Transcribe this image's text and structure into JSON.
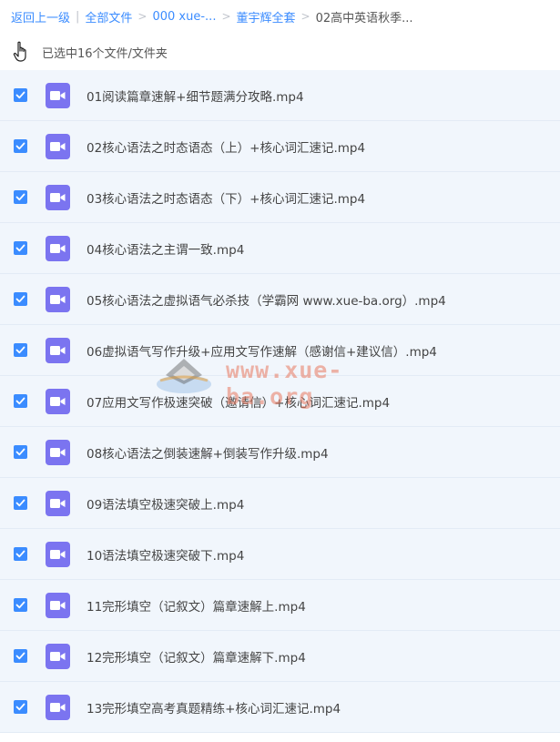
{
  "breadcrumb": {
    "back": "返回上一级",
    "all_files": "全部文件",
    "level1": "000 xue-...",
    "level2": "董宇辉全套",
    "current": "02高中英语秋季...",
    "sep": ">",
    "bar": "|"
  },
  "selection": {
    "text": "已选中16个文件/文件夹"
  },
  "files": [
    {
      "name": "01阅读篇章速解+细节题满分攻略.mp4"
    },
    {
      "name": "02核心语法之时态语态（上）+核心词汇速记.mp4"
    },
    {
      "name": "03核心语法之时态语态（下）+核心词汇速记.mp4"
    },
    {
      "name": "04核心语法之主谓一致.mp4"
    },
    {
      "name": "05核心语法之虚拟语气必杀技（学霸网 www.xue-ba.org）.mp4"
    },
    {
      "name": "06虚拟语气写作升级+应用文写作速解（感谢信+建议信）.mp4"
    },
    {
      "name": "07应用文写作极速突破（邀请信）+核心词汇速记.mp4"
    },
    {
      "name": "08核心语法之倒装速解+倒装写作升级.mp4"
    },
    {
      "name": "09语法填空极速突破上.mp4"
    },
    {
      "name": "10语法填空极速突破下.mp4"
    },
    {
      "name": "11完形填空（记叙文）篇章速解上.mp4"
    },
    {
      "name": "12完形填空（记叙文）篇章速解下.mp4"
    },
    {
      "name": "13完形填空高考真题精练+核心词汇速记.mp4"
    }
  ],
  "watermark": {
    "text": "www.xue-ba.org"
  },
  "colors": {
    "accent": "#3b8cff",
    "video_icon": "#7b74f0",
    "row_bg": "#f1f6fc"
  },
  "icons": {
    "file": "video-file-icon",
    "checkbox": "checkbox-checked-icon",
    "cursor": "hand-cursor-icon"
  }
}
